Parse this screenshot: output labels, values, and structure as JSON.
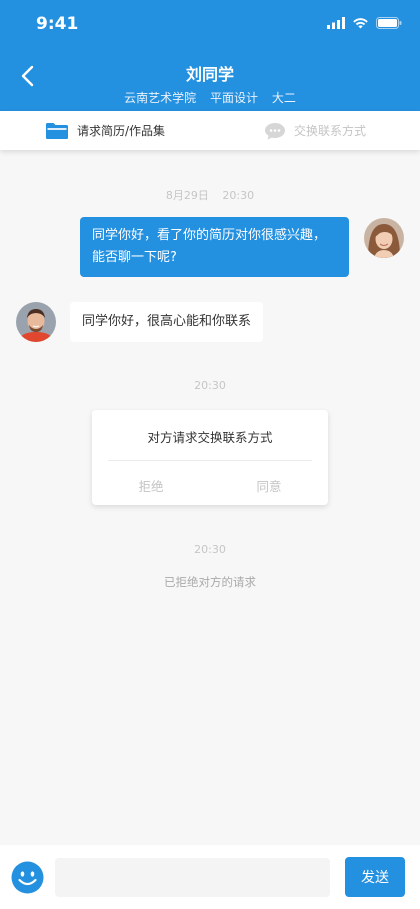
{
  "status_bar": {
    "time": "9:41"
  },
  "header": {
    "title": "刘同学",
    "subtitle": {
      "school": "云南艺术学院",
      "major": "平面设计",
      "grade": "大二"
    }
  },
  "actions": {
    "request_resume": "请求简历/作品集",
    "exchange_contact": "交换联系方式"
  },
  "messages": {
    "timestamp_1": {
      "date": "8月29日",
      "time": "20:30"
    },
    "sent_message": "同学你好，看了你的简历对你很感兴趣，能否聊一下呢?",
    "received_message": "同学你好，很高心能和你联系",
    "timestamp_2": "20:30",
    "request_card": {
      "title": "对方请求交换联系方式",
      "reject": "拒绝",
      "agree": "同意"
    },
    "timestamp_3": "20:30",
    "system_notice": "已拒绝对方的请求"
  },
  "composer": {
    "input_value": "",
    "send_label": "发送"
  },
  "colors": {
    "primary": "#2490e0",
    "background": "#f7f7f7",
    "muted_text": "#c4c4c4"
  }
}
